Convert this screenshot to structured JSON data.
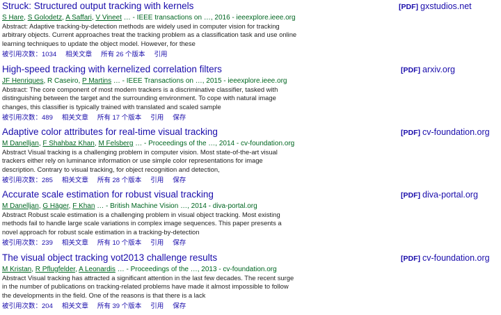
{
  "results": [
    {
      "title": "Struck: Structured output tracking with kernels",
      "authors": [
        "S Hare",
        "S Golodetz",
        "A Saffari",
        "V Vineet"
      ],
      "venue": "… - IEEE transactions on …, 2016 - ieeexplore.ieee.org",
      "abstract": "Abstract: Adaptive tracking-by-detection methods are widely used in computer vision for tracking arbitrary objects. Current approaches treat the tracking problem as a classification task and use online learning techniques to update the object model. However, for these",
      "cited_by": "被引用次数：1034",
      "related": "相关文章",
      "versions": "所有 26 个版本",
      "cite": "引用",
      "save": "",
      "pdf_tag": "[PDF]",
      "pdf_source": "gxstudios.net"
    },
    {
      "title": "High-speed tracking with kernelized correlation filters",
      "authors": [
        "JF Henriques",
        "R Caseiro",
        "P Martins"
      ],
      "venue": "… - IEEE Transactions on …, 2015 - ieeexplore.ieee.org",
      "abstract": "Abstract: The core component of most modern trackers is a discriminative classifier, tasked with distinguishing between the target and the surrounding environment. To cope with natural image changes, this classifier is typically trained with translated and scaled sample",
      "cited_by": "被引用次数：489",
      "related": "相关文章",
      "versions": "所有 17 个版本",
      "cite": "引用",
      "save": "保存",
      "pdf_tag": "[PDF]",
      "pdf_source": "arxiv.org"
    },
    {
      "title": "Adaptive color attributes for real-time visual tracking",
      "authors": [
        "M Danelljan",
        "F Shahbaz Khan",
        "M Felsberg"
      ],
      "venue": "… - Proceedings of the …, 2014 - cv-foundation.org",
      "abstract": "Abstract Visual tracking is a challenging problem in computer vision. Most state-of-the-art visual trackers either rely on luminance information or use simple color representations for image description. Contrary to visual tracking, for object recognition and detection,",
      "cited_by": "被引用次数：285",
      "related": "相关文章",
      "versions": "所有 28 个版本",
      "cite": "引用",
      "save": "保存",
      "pdf_tag": "[PDF]",
      "pdf_source": "cv-foundation.org"
    },
    {
      "title": "Accurate scale estimation for robust visual tracking",
      "authors": [
        "M Danelljan",
        "G Häger",
        "F Khan"
      ],
      "venue": "… - British Machine Vision …, 2014 - diva-portal.org",
      "abstract": "Abstract Robust scale estimation is a challenging problem in visual object tracking. Most existing methods fail to handle large scale variations in complex image sequences. This paper presents a novel approach for robust scale estimation in a tracking-by-detection",
      "cited_by": "被引用次数：239",
      "related": "相关文章",
      "versions": "所有 10 个版本",
      "cite": "引用",
      "save": "保存",
      "pdf_tag": "[PDF]",
      "pdf_source": "diva-portal.org"
    },
    {
      "title": "The visual object tracking vot2013 challenge results",
      "authors": [
        "M Kristan",
        "R Pflugfelder",
        "A Leonardis"
      ],
      "venue": "… - Proceedings of the …, 2013 - cv-foundation.org",
      "abstract": "Abstract Visual tracking has attracted a significant attention in the last few decades. The recent surge in the number of publications on tracking-related problems have made it almost impossible to follow the developments in the field. One of the reasons is that there is a lack",
      "cited_by": "被引用次数：204",
      "related": "相关文章",
      "versions": "所有 39 个版本",
      "cite": "引用",
      "save": "保存",
      "pdf_tag": "[PDF]",
      "pdf_source": "cv-foundation.org"
    }
  ],
  "colors": {
    "title": "#1a0dab",
    "authors": "#006621",
    "text": "#222222"
  }
}
